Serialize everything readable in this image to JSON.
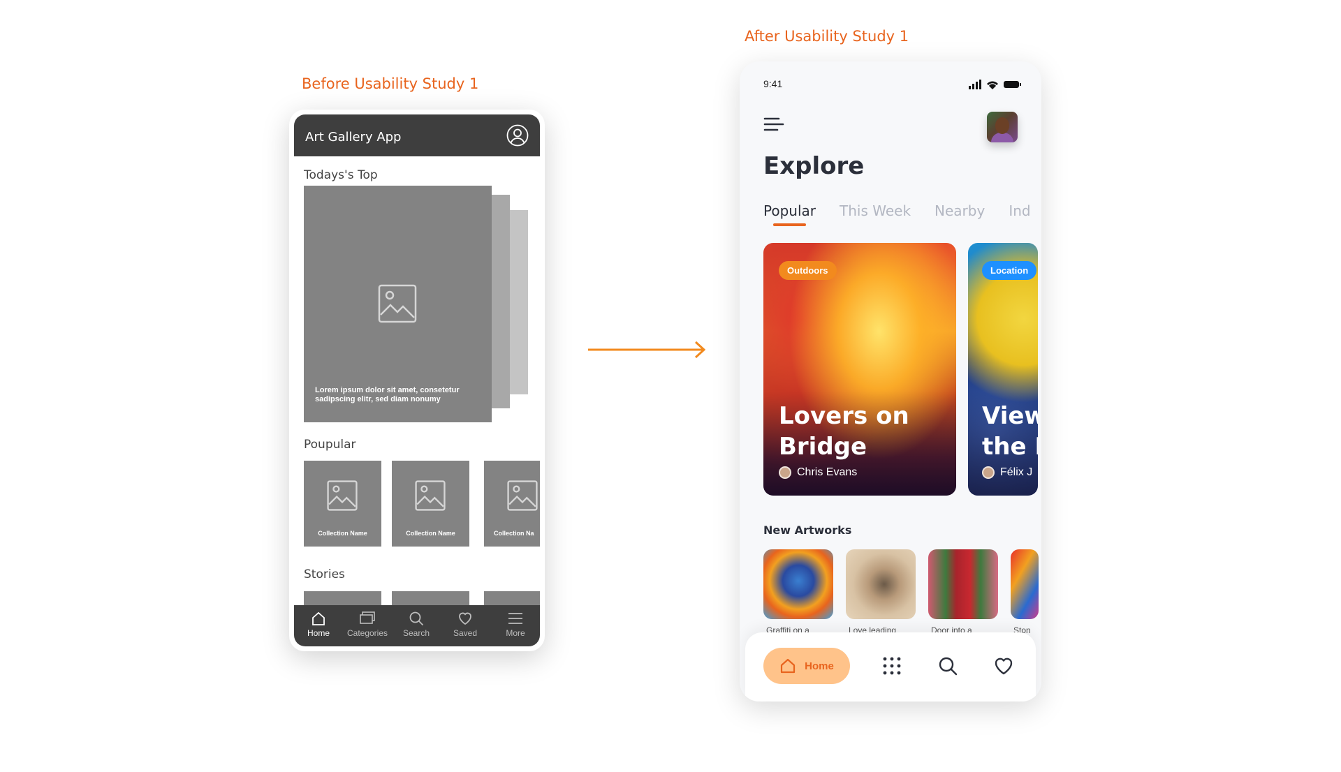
{
  "captions": {
    "before": "Before Usability Study 1",
    "after": "After Usability Study 1"
  },
  "wireframe": {
    "app_title": "Art Gallery App",
    "sections": {
      "top": "Todays's Top",
      "popular": "Poupular",
      "stories": "Stories"
    },
    "top_card_text": "Lorem ipsum dolor sit amet, consetetur sadipscing elitr, sed diam nonumy",
    "collections": [
      "Collection Name",
      "Collection Name",
      "Collection Na"
    ],
    "nav": [
      {
        "label": "Home",
        "icon": "home-icon"
      },
      {
        "label": "Categories",
        "icon": "categories-icon"
      },
      {
        "label": "Search",
        "icon": "search-icon"
      },
      {
        "label": "Saved",
        "icon": "heart-icon"
      },
      {
        "label": "More",
        "icon": "menu-icon"
      }
    ]
  },
  "app": {
    "status_time": "9:41",
    "heading": "Explore",
    "tabs": [
      "Popular",
      "This Week",
      "Nearby",
      "Ind"
    ],
    "featured": [
      {
        "badge": "Outdoors",
        "title_line1": "Lovers on",
        "title_line2": "Bridge",
        "author": "Chris Evans"
      },
      {
        "badge": "Location",
        "title_line1": "View",
        "title_line2": "the I",
        "author": "Félix J"
      }
    ],
    "new_artworks_title": "New Artworks",
    "artworks": [
      "Graffiti on a",
      "Love leading",
      "Door into a",
      "Ston"
    ],
    "nav_home": "Home",
    "accent_color": "#e8641e"
  }
}
